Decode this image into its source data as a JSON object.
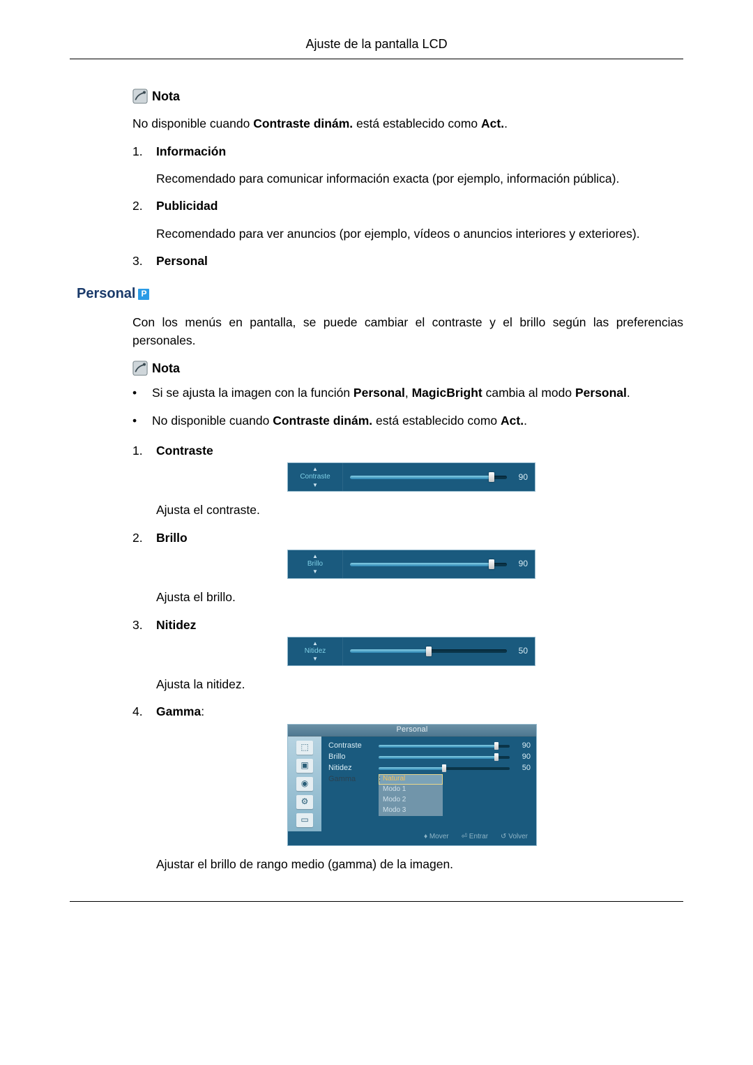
{
  "header": {
    "title": "Ajuste de la pantalla LCD"
  },
  "nota1": {
    "label": "Nota",
    "text_pre": "No disponible cuando ",
    "text_bold": "Contraste dinám.",
    "text_mid": " está establecido como ",
    "text_bold2": "Act.",
    "text_post": "."
  },
  "modes": [
    {
      "num": "1.",
      "label": "Información",
      "desc": "Recomendado para comunicar información exacta (por ejemplo, información pública)."
    },
    {
      "num": "2.",
      "label": "Publicidad",
      "desc": "Recomendado para ver anuncios (por ejemplo, vídeos o anuncios interiores y exteriores)."
    },
    {
      "num": "3.",
      "label": "Personal",
      "desc": ""
    }
  ],
  "section_personal": {
    "heading": "Personal",
    "badge": "P",
    "intro": "Con los menús en pantalla, se puede cambiar el contraste y el brillo según las preferencias personales."
  },
  "nota2": {
    "label": "Nota",
    "bullets": [
      {
        "pre": "Si se ajusta la imagen con la función ",
        "b1": "Personal",
        "mid1": ", ",
        "b2": "MagicBright",
        "mid2": " cambia al modo ",
        "b3": "Personal",
        "post": "."
      },
      {
        "pre": "No disponible cuando ",
        "b1": "Contraste dinám.",
        "mid1": " está establecido como ",
        "b2": "Act.",
        "mid2": "",
        "b3": "",
        "post": "."
      }
    ]
  },
  "settings": [
    {
      "num": "1.",
      "label": "Contraste",
      "slider_label": "Contraste",
      "value": 90,
      "desc": "Ajusta el contraste."
    },
    {
      "num": "2.",
      "label": "Brillo",
      "slider_label": "Brillo",
      "value": 90,
      "desc": "Ajusta el brillo."
    },
    {
      "num": "3.",
      "label": "Nitidez",
      "slider_label": "Nitidez",
      "value": 50,
      "desc": "Ajusta la nitidez."
    },
    {
      "num": "4.",
      "label": "Gamma",
      "label_suffix": ":",
      "desc": "Ajustar el brillo de rango medio (gamma) de la imagen."
    }
  ],
  "gamma_menu": {
    "title": "Personal",
    "rows": [
      {
        "label": "Contraste",
        "value": 90
      },
      {
        "label": "Brillo",
        "value": 90
      },
      {
        "label": "Nitidez",
        "value": 50
      }
    ],
    "gamma_label": "Gamma",
    "gamma_prefix": ":",
    "options": [
      "Natural",
      "Modo 1",
      "Modo 2",
      "Modo 3"
    ],
    "selected_option": 0,
    "footer": {
      "move": "Mover",
      "enter": "Entrar",
      "back": "Volver"
    }
  }
}
